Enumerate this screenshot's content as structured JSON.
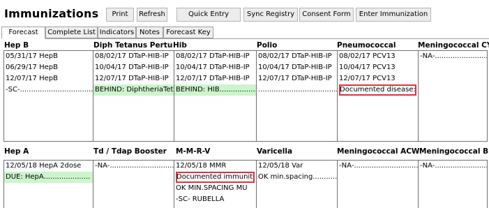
{
  "window": {
    "title": "Immunizations"
  },
  "toolbar": {
    "print": "Print",
    "refresh": "Refresh",
    "quick_entry": "Quick Entry",
    "sync_registry": "Sync Registry",
    "consent_form": "Consent Form",
    "enter_immunization": "Enter Immunization"
  },
  "tabs": [
    "Forecast",
    "Complete List",
    "Indicators",
    "Notes",
    "Forecast Key"
  ],
  "active_tab": "Forecast",
  "colors": {
    "due_highlight": "#ccf5cc",
    "callout_border": "#e0323a",
    "box_border": "#707070"
  },
  "grid_top": [
    {
      "header": "Hep B",
      "rows": [
        {
          "text": "05/31/17  HepB"
        },
        {
          "text": "06/29/17  HepB"
        },
        {
          "text": "12/07/17  HepB"
        },
        {
          "text": "-SC-............................................"
        }
      ]
    },
    {
      "header": "Diph Tetanus Pertuss",
      "rows": [
        {
          "text": "08/02/17  DTaP-HIB-IP"
        },
        {
          "text": "10/04/17  DTaP-HIB-IP"
        },
        {
          "text": "12/07/17  DTaP-HIB-IP"
        },
        {
          "text": "BEHIND: DiphtheriaTet",
          "green": true
        }
      ]
    },
    {
      "header": "Hib",
      "rows": [
        {
          "text": "08/02/17  DTaP-HIB-IP"
        },
        {
          "text": "10/04/17  DTaP-HIB-IP"
        },
        {
          "text": "12/07/17  DTaP-HIB-IP"
        },
        {
          "text": "BEHIND: HIB....................",
          "green": true
        }
      ]
    },
    {
      "header": "Polio",
      "rows": [
        {
          "text": "08/02/17  DTaP-HIB-IP"
        },
        {
          "text": "10/04/17  DTaP-HIB-IP"
        },
        {
          "text": "12/07/17  DTaP-HIB-IP"
        },
        {
          "text": "...................................................."
        }
      ]
    },
    {
      "header": "Pneumococcal",
      "rows": [
        {
          "text": "08/02/17  PCV13"
        },
        {
          "text": "10/04/17  PCV13"
        },
        {
          "text": "12/07/17  PCV13"
        },
        {
          "text": "Documented disease:",
          "highlight": true
        }
      ]
    },
    {
      "header": "Meningococcal CY",
      "rows": [
        {
          "text": "-NA-..............................................."
        }
      ]
    }
  ],
  "grid_bottom": [
    {
      "header": "Hep A",
      "rows": [
        {
          "text": "12/05/18  HepA 2dose"
        },
        {
          "text": "DUE: HepA.....................",
          "green": true
        }
      ]
    },
    {
      "header": "Td / Tdap Booster",
      "rows": [
        {
          "text": "-NA-..............................................."
        }
      ]
    },
    {
      "header": "M-M-R-V",
      "rows": [
        {
          "text": "12/05/18  MMR"
        },
        {
          "text": "Documented immunity",
          "highlight": true
        },
        {
          "text": "OK MIN.SPACING MU"
        },
        {
          "text": "-SC- RUBELLA"
        }
      ]
    },
    {
      "header": "Varicella",
      "rows": [
        {
          "text": "12/05/18  Var"
        },
        {
          "text": "OK min.spacing............"
        }
      ]
    },
    {
      "header": "Meningococcal ACWY",
      "rows": [
        {
          "text": "-NA-..............................................."
        }
      ]
    },
    {
      "header": "Meningococcal B",
      "rows": [
        {
          "text": "-NA-..............................................."
        }
      ]
    }
  ]
}
